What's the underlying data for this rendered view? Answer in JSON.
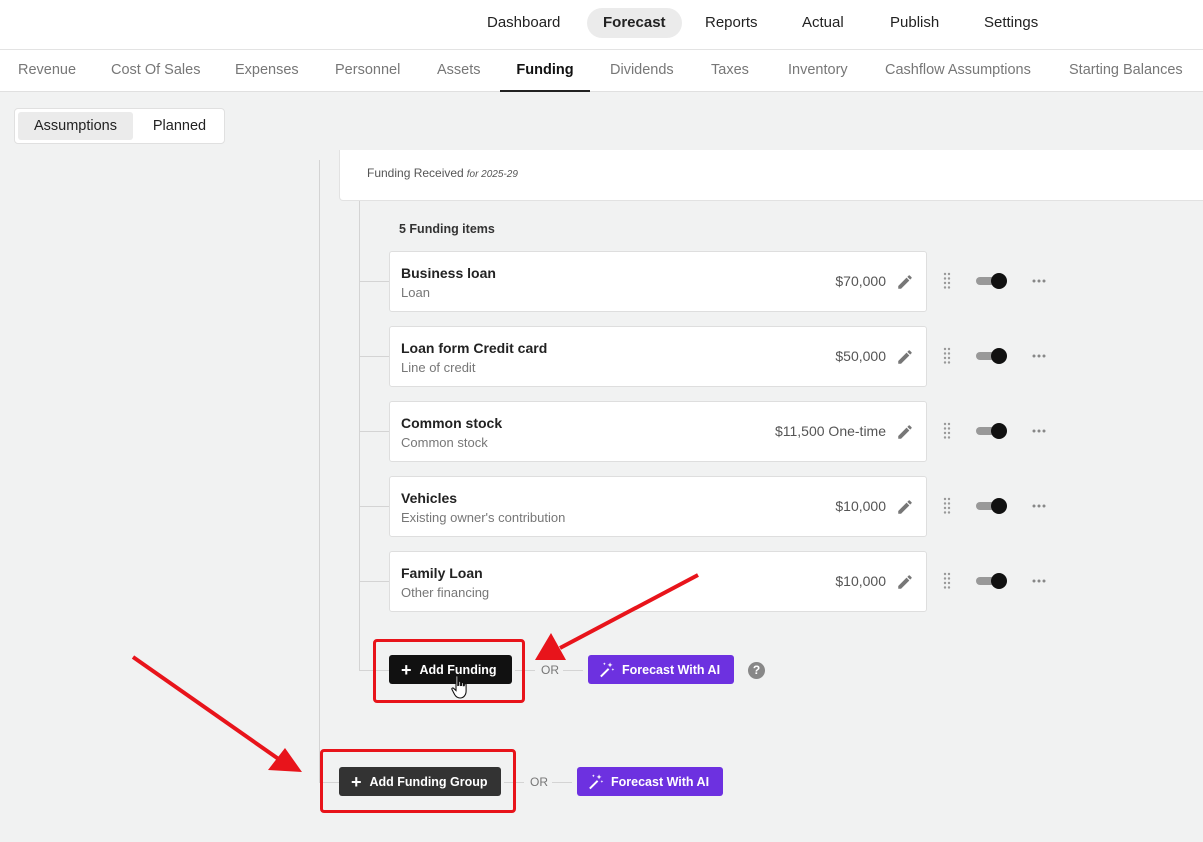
{
  "topnav": {
    "items": [
      {
        "label": "Dashboard",
        "active": false
      },
      {
        "label": "Forecast",
        "active": true
      },
      {
        "label": "Reports",
        "active": false
      },
      {
        "label": "Actual",
        "active": false
      },
      {
        "label": "Publish",
        "active": false
      },
      {
        "label": "Settings",
        "active": false
      }
    ]
  },
  "subtabs": [
    {
      "label": "Revenue",
      "active": false
    },
    {
      "label": "Cost Of Sales",
      "active": false
    },
    {
      "label": "Expenses",
      "active": false
    },
    {
      "label": "Personnel",
      "active": false
    },
    {
      "label": "Assets",
      "active": false
    },
    {
      "label": "Funding",
      "active": true
    },
    {
      "label": "Dividends",
      "active": false
    },
    {
      "label": "Taxes",
      "active": false
    },
    {
      "label": "Inventory",
      "active": false
    },
    {
      "label": "Cashflow Assumptions",
      "active": false
    },
    {
      "label": "Starting Balances",
      "active": false
    }
  ],
  "segmented": {
    "assumptions": "Assumptions",
    "planned": "Planned",
    "active": "Assumptions"
  },
  "group": {
    "title": "Funding Received",
    "period": "for 2025-29",
    "count_label": "5 Funding items",
    "items": [
      {
        "name": "Business loan",
        "type": "Loan",
        "amount": "$70,000",
        "enabled": true
      },
      {
        "name": "Loan form Credit card",
        "type": "Line of credit",
        "amount": "$50,000",
        "enabled": true
      },
      {
        "name": "Common stock",
        "type": "Common stock",
        "amount": "$11,500 One-time",
        "enabled": true
      },
      {
        "name": "Vehicles",
        "type": "Existing owner's contribution",
        "amount": "$10,000",
        "enabled": true
      },
      {
        "name": "Family Loan",
        "type": "Other financing",
        "amount": "$10,000",
        "enabled": true
      }
    ],
    "add_label": "Add Funding",
    "or_label": "OR",
    "ai_label": "Forecast With AI",
    "help": "?"
  },
  "footer": {
    "add_group_label": "Add Funding Group",
    "or_label": "OR",
    "ai_label": "Forecast With AI"
  },
  "colors": {
    "ai": "#6d31e0",
    "highlight": "#e8141b",
    "dark": "#111111"
  },
  "icons": [
    "pencil-icon",
    "drag-handle-icon",
    "toggle-switch",
    "more-horizontal-icon",
    "plus-icon",
    "magic-wand-icon",
    "help-icon",
    "hand-cursor-icon"
  ]
}
